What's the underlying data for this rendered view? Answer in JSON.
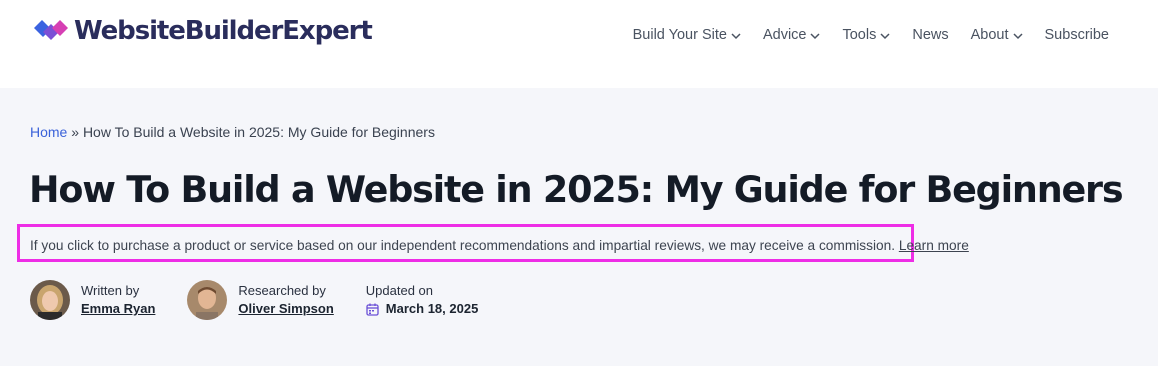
{
  "header": {
    "logo_text": "WebsiteBuilderExpert",
    "logo_colors": [
      "#3b63e0",
      "#7b4fd6",
      "#d63fb4"
    ],
    "nav": [
      {
        "label": "Build Your Site",
        "has_dropdown": true,
        "icon": "chevron-down-icon"
      },
      {
        "label": "Advice",
        "has_dropdown": true,
        "icon": "chevron-down-icon"
      },
      {
        "label": "Tools",
        "has_dropdown": true,
        "icon": "chevron-down-icon"
      },
      {
        "label": "News",
        "has_dropdown": false
      },
      {
        "label": "About",
        "has_dropdown": true,
        "icon": "chevron-down-icon"
      },
      {
        "label": "Subscribe",
        "has_dropdown": false
      }
    ]
  },
  "breadcrumb": {
    "home": "Home",
    "separator": "»",
    "current": "How To Build a Website in 2025: My Guide for Beginners"
  },
  "article": {
    "title": "How To Build a Website in 2025: My Guide for Beginners",
    "disclosure": "If you click to purchase a product or service based on our independent recommendations and impartial reviews, we may receive a commission.",
    "learn_more": "Learn more",
    "highlight_color": "#ee2de6"
  },
  "meta": {
    "written_by_label": "Written by",
    "written_by_name": "Emma Ryan",
    "researched_by_label": "Researched by",
    "researched_by_name": "Oliver Simpson",
    "updated_label": "Updated on",
    "updated_date": "March 18, 2025",
    "calendar_icon": "calendar-icon"
  }
}
